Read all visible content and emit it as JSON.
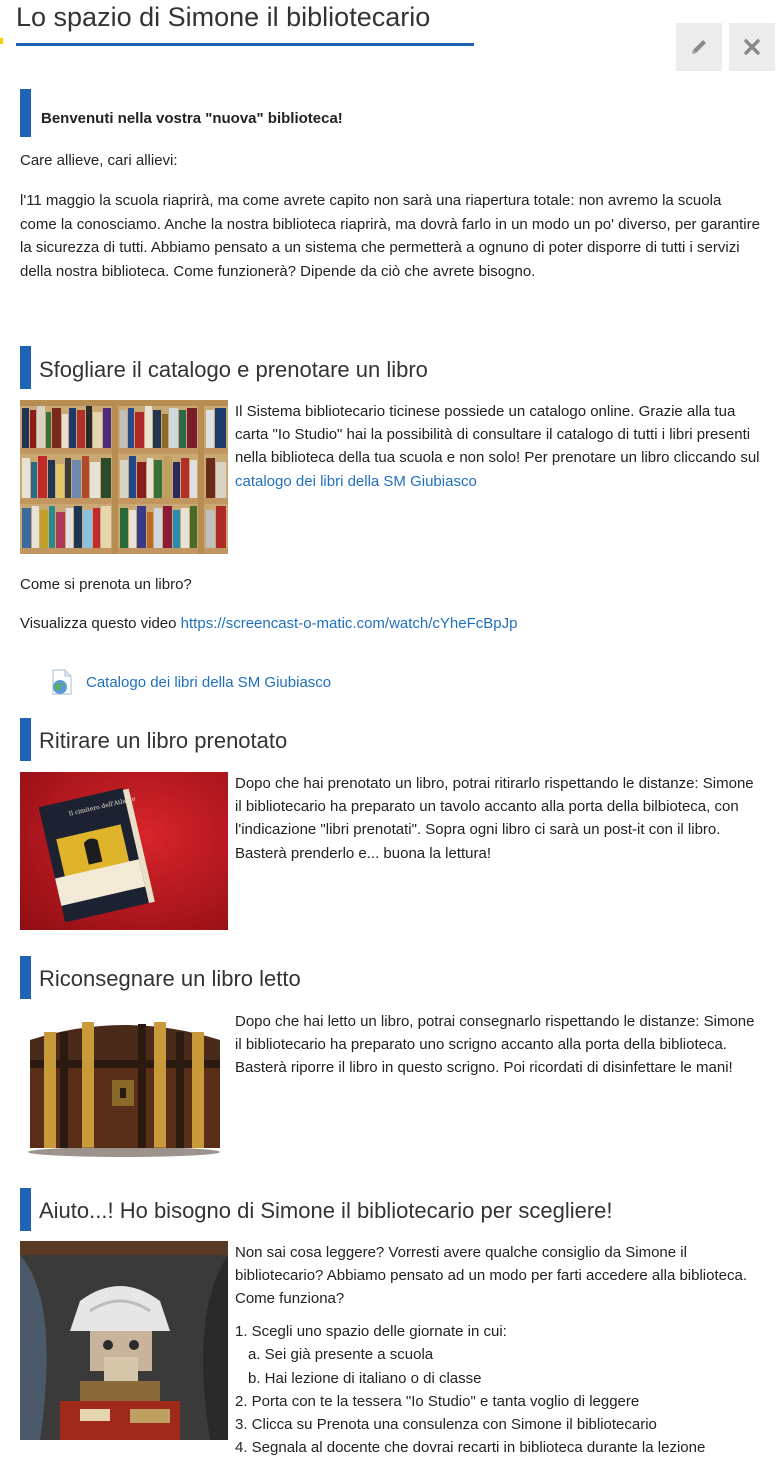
{
  "header": {
    "title": "Lo spazio di Simone il bibliotecario",
    "edit_icon": "pencil-icon",
    "close_icon": "close-icon"
  },
  "welcome": {
    "heading": "Benvenuti nella vostra  \"nuova\" biblioteca!",
    "greeting": "Care allieve, cari allievi:",
    "body": "l'11 maggio la scuola riaprirà, ma come avrete capito non sarà una riapertura totale: non avremo la scuola come la conosciamo. Anche la nostra biblioteca riaprirà, ma dovrà farlo in un modo un po' diverso, per garantire la sicurezza di tutti. Abbiamo pensato a un sistema che permetterà a ognuno di poter disporre di tutti i servizi della nostra biblioteca. Come funzionerà? Dipende da ciò che avrete bisogno."
  },
  "catalog": {
    "heading": "Sfogliare il catalogo e prenotare un libro",
    "text": "Il Sistema bibliotecario ticinese possiede un catalogo online. Grazie alla tua carta \"Io Studio\" hai la possibilità di consultare il catalogo di tutti i libri presenti nella biblioteca della tua scuola e non solo! Per prenotare un libro cliccando sul ",
    "link": "catalogo dei libri della SM Giubiasco",
    "question": "Come si prenota un libro?",
    "video_prefix": "Visualizza questo video ",
    "video_link": "https://screencast-o-matic.com/watch/cYheFcBpJp",
    "resource_link": "Catalogo dei libri della SM Giubiasco",
    "resource_icon": "web-page-icon"
  },
  "pickup": {
    "heading": "Ritirare un libro prenotato",
    "text": "Dopo che hai prenotato un libro, potrai ritirarlo rispettando le distanze: Simone il bibliotecario ha preparato un tavolo accanto alla porta della bilbioteca, con l'indicazione \"libri prenotati\". Sopra ogni libro ci sarà un post-it con il libro. Basterà prenderlo e... buona la lettura!",
    "book_title": "Il cimitero dell'Atlante"
  },
  "return": {
    "heading": "Riconsegnare un libro letto",
    "text": "Dopo che hai letto un libro, potrai consegnarlo rispettando le distanze: Simone il bibliotecario ha preparato uno scrigno accanto alla porta della biblioteca. Basterà riporre il libro in questo scrigno. Poi ricordati di disinfettare le mani!"
  },
  "help": {
    "heading": "Aiuto...! Ho bisogno di Simone il bibliotecario per scegliere!",
    "intro": "Non sai cosa leggere? Vorresti avere qualche consiglio da Simone il bibliotecario? Abbiamo pensato ad un modo per farti accedere alla biblioteca. Come funziona?",
    "steps": [
      "1. Scegli uno spazio delle giornate in cui:",
      "a. Sei già presente a scuola",
      "b. Hai lezione di italiano o di classe",
      "2. Porta con te la tessera \"Io Studio\" e tanta voglio di leggere",
      "3. Clicca su Prenota una consulenza con Simone il bibliotecario",
      "4. Segnala al docente che dovrai recarti in biblioteca durante la lezione"
    ]
  }
}
